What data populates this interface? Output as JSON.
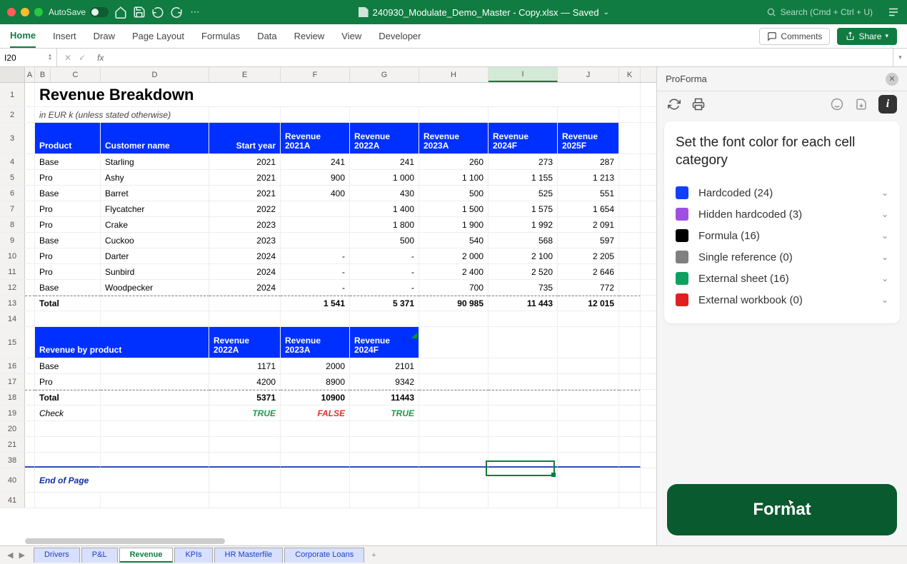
{
  "window": {
    "autosave": "AutoSave",
    "title": "240930_Modulate_Demo_Master - Copy.xlsx — Saved",
    "search_placeholder": "Search (Cmd + Ctrl + U)"
  },
  "ribbon": {
    "tabs": [
      "Home",
      "Insert",
      "Draw",
      "Page Layout",
      "Formulas",
      "Data",
      "Review",
      "View",
      "Developer"
    ],
    "active": 0,
    "comments": "Comments",
    "share": "Share"
  },
  "namebox": "I20",
  "columns": [
    "A",
    "B",
    "C",
    "D",
    "E",
    "F",
    "G",
    "H",
    "I",
    "J",
    "K"
  ],
  "selected_col_index": 8,
  "title": "Revenue Breakdown",
  "subtitle": "in EUR k (unless stated otherwise)",
  "headers1": {
    "product": "Product",
    "customer": "Customer name",
    "start": "Start year",
    "r21": "Revenue 2021A",
    "r22": "Revenue 2022A",
    "r23": "Revenue 2023A",
    "r24": "Revenue 2024F",
    "r25": "Revenue 2025F"
  },
  "products": [
    {
      "n": "4",
      "p": "Base",
      "c": "Starling",
      "y": "2021",
      "r": [
        "241",
        "241",
        "260",
        "273",
        "287"
      ]
    },
    {
      "n": "5",
      "p": "Pro",
      "c": "Ashy",
      "y": "2021",
      "r": [
        "900",
        "1 000",
        "1 100",
        "1 155",
        "1 213"
      ]
    },
    {
      "n": "6",
      "p": "Base",
      "c": "Barret",
      "y": "2021",
      "r": [
        "400",
        "430",
        "500",
        "525",
        "551"
      ]
    },
    {
      "n": "7",
      "p": "Pro",
      "c": "Flycatcher",
      "y": "2022",
      "r": [
        "",
        "1 400",
        "1 500",
        "1 575",
        "1 654"
      ]
    },
    {
      "n": "8",
      "p": "Pro",
      "c": "Crake",
      "y": "2023",
      "r": [
        "",
        "1 800",
        "1 900",
        "1 992",
        "2 091"
      ]
    },
    {
      "n": "9",
      "p": "Base",
      "c": "Cuckoo",
      "y": "2023",
      "r": [
        "",
        "500",
        "540",
        "568",
        "597"
      ]
    },
    {
      "n": "10",
      "p": "Pro",
      "c": "Darter",
      "y": "2024",
      "r": [
        "-",
        "-",
        "2 000",
        "2 100",
        "2 205"
      ]
    },
    {
      "n": "11",
      "p": "Pro",
      "c": "Sunbird",
      "y": "2024",
      "r": [
        "-",
        "-",
        "2 400",
        "2 520",
        "2 646"
      ]
    },
    {
      "n": "12",
      "p": "Base",
      "c": "Woodpecker",
      "y": "2024",
      "r": [
        "-",
        "-",
        "700",
        "735",
        "772"
      ]
    }
  ],
  "total1": {
    "label": "Total",
    "r": [
      "1 541",
      "5 371",
      "90 985",
      "11 443",
      "12 015"
    ]
  },
  "headers2": {
    "label": "Revenue by product",
    "r22": "Revenue 2022A",
    "r23": "Revenue 2023A",
    "r24": "Revenue 2024F"
  },
  "byproduct": [
    {
      "n": "16",
      "p": "Base",
      "r": [
        "1171",
        "2000",
        "2101"
      ]
    },
    {
      "n": "17",
      "p": "Pro",
      "r": [
        "4200",
        "8900",
        "9342"
      ]
    }
  ],
  "total2": {
    "label": "Total",
    "r": [
      "5371",
      "10900",
      "11443"
    ]
  },
  "check": {
    "label": "Check",
    "r": [
      "TRUE",
      "FALSE",
      "TRUE"
    ]
  },
  "eop": "End of Page",
  "panel": {
    "name": "ProForma",
    "heading": "Set the font color for each cell category",
    "cats": [
      {
        "color": "#1040ff",
        "label": "Hardcoded (24)"
      },
      {
        "color": "#a050e0",
        "label": "Hidden hardcoded (3)"
      },
      {
        "color": "#000000",
        "label": "Formula (16)"
      },
      {
        "color": "#808080",
        "label": "Single reference (0)"
      },
      {
        "color": "#10a060",
        "label": "External sheet (16)"
      },
      {
        "color": "#e02020",
        "label": "External workbook (0)"
      }
    ],
    "format_btn": "Format"
  },
  "sheets": [
    "Drivers",
    "P&L",
    "Revenue",
    "KPIs",
    "HR Masterfile",
    "Corporate Loans"
  ],
  "active_sheet": 2
}
